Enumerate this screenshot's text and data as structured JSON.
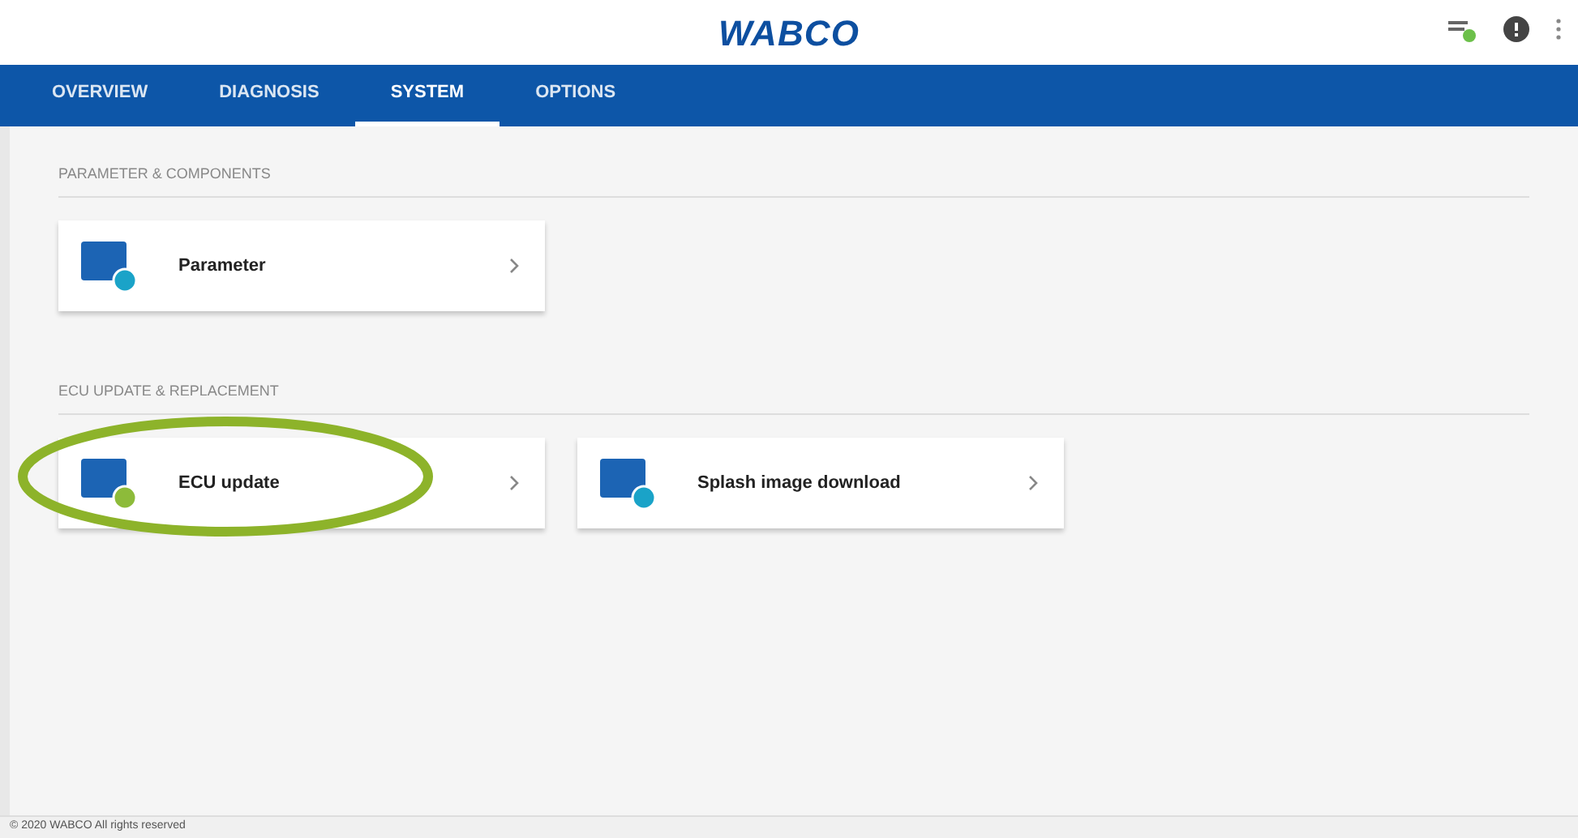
{
  "header": {
    "logo": "WABCO"
  },
  "tabs": [
    {
      "label": "OVERVIEW",
      "selected": false
    },
    {
      "label": "DIAGNOSIS",
      "selected": false
    },
    {
      "label": "SYSTEM",
      "selected": true
    },
    {
      "label": "OPTIONS",
      "selected": false
    }
  ],
  "sections": [
    {
      "title": "PARAMETER & COMPONENTS",
      "tiles": [
        {
          "label": "Parameter",
          "color": "#1aa3c8",
          "highlighted": false
        }
      ]
    },
    {
      "title": "ECU UPDATE & REPLACEMENT",
      "tiles": [
        {
          "label": "ECU update",
          "color": "#8dbb3a",
          "highlighted": true
        },
        {
          "label": "Splash image download",
          "color": "#1aa3c8",
          "highlighted": false
        }
      ]
    }
  ],
  "footer": "© 2020 WABCO All rights reserved"
}
